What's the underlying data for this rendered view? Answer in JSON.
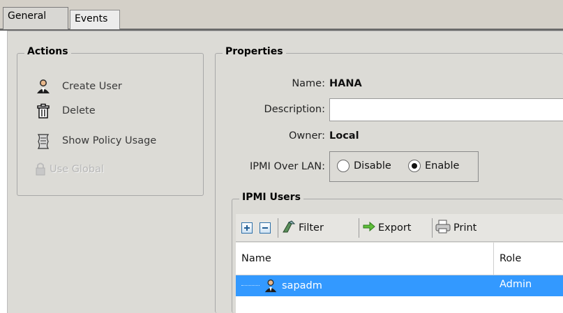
{
  "tabs": [
    {
      "label": "General"
    },
    {
      "label": "Events"
    }
  ],
  "actions": {
    "title": "Actions",
    "items": [
      {
        "label": "Create User",
        "icon": "user-icon"
      },
      {
        "label": "Delete",
        "icon": "trash-icon"
      },
      {
        "label": "Show Policy Usage",
        "icon": "scroll-icon"
      },
      {
        "label": "Use Global",
        "icon": "lock-icon"
      }
    ]
  },
  "properties": {
    "title": "Properties",
    "name_label": "Name:",
    "name_value": "HANA",
    "description_label": "Description:",
    "description_value": "",
    "owner_label": "Owner:",
    "owner_value": "Local",
    "ipmi_label": "IPMI Over LAN:",
    "ipmi_options": [
      "Disable",
      "Enable"
    ],
    "ipmi_selected": "Enable"
  },
  "ipmi_users": {
    "title": "IPMI Users",
    "toolbar": {
      "filter": "Filter",
      "export": "Export",
      "print": "Print"
    },
    "columns": [
      "Name",
      "Role"
    ],
    "rows": [
      {
        "name": "sapadm",
        "role": "Admin",
        "selected": true
      }
    ]
  },
  "colors": {
    "selection": "#3399ff",
    "panel": "#dcdbd6"
  }
}
